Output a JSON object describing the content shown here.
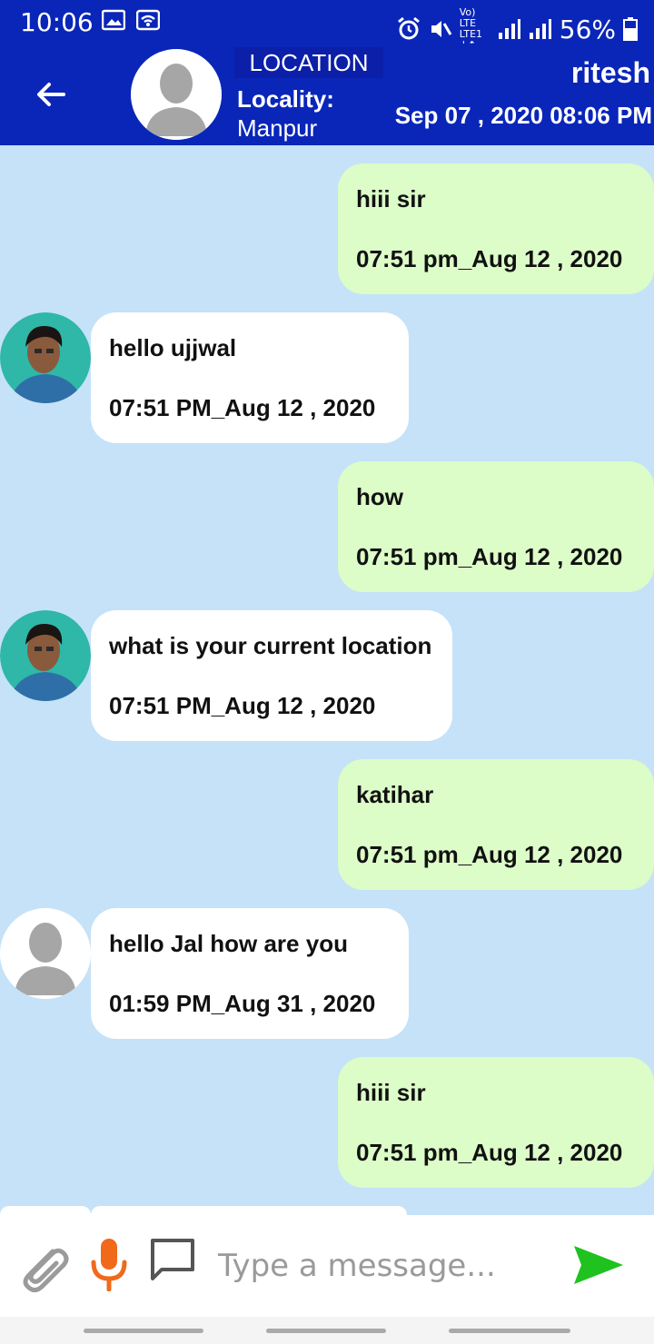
{
  "status_bar": {
    "time": "10:06",
    "network": "Vo) LTE",
    "network2": "LTE1 ↓↑",
    "battery": "56%"
  },
  "header": {
    "location_title": "LOCATION",
    "locality_label": "Locality:",
    "locality_value": "Manpur",
    "user_name": "ritesh",
    "date": "Sep 07 , 2020 08:06 PM"
  },
  "messages": [
    {
      "side": "sent",
      "text": "hiii sir",
      "time": "07:51 pm_Aug 12 , 2020"
    },
    {
      "side": "received",
      "avatar": "photo",
      "text": "hello ujjwal",
      "time": "07:51 PM_Aug 12 , 2020"
    },
    {
      "side": "sent",
      "text": "how",
      "time": "07:51 pm_Aug 12 , 2020"
    },
    {
      "side": "received",
      "avatar": "photo",
      "text": "what is your current location",
      "time": "07:51 PM_Aug 12 , 2020"
    },
    {
      "side": "sent",
      "text": "katihar",
      "time": "07:51 pm_Aug 12 , 2020"
    },
    {
      "side": "received",
      "avatar": "default",
      "text": "hello Jal how are you",
      "time": "01:59 PM_Aug 31 , 2020"
    },
    {
      "side": "sent",
      "text": "hiii sir",
      "time": "07:51 pm_Aug 12 , 2020"
    }
  ],
  "composer": {
    "placeholder": "Type a message..."
  },
  "colors": {
    "header": "#0a26b8",
    "background": "#c5e2f8",
    "sent_bubble": "#dcfcc8",
    "received_bubble": "#ffffff",
    "send": "#1fc21f",
    "mic": "#f06a1a"
  },
  "icons": [
    "back-arrow-icon",
    "paperclip-icon",
    "mic-icon",
    "chat-bubble-icon",
    "send-icon"
  ]
}
